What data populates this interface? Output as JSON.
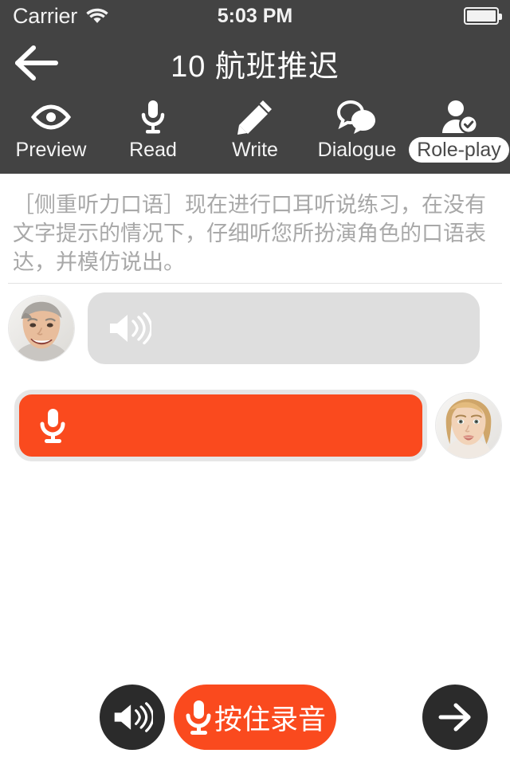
{
  "status_bar": {
    "carrier": "Carrier",
    "wifi_icon": "wifi-icon",
    "time": "5:03 PM",
    "battery_icon": "battery-full-icon"
  },
  "nav": {
    "back_icon": "arrow-left-icon",
    "title": "10 航班推迟"
  },
  "toolbar": {
    "items": [
      {
        "label": "Preview",
        "icon": "eye-icon",
        "active": false
      },
      {
        "label": "Read",
        "icon": "microphone-icon",
        "active": false
      },
      {
        "label": "Write",
        "icon": "pencil-icon",
        "active": false
      },
      {
        "label": "Dialogue",
        "icon": "speech-bubbles-icon",
        "active": false
      },
      {
        "label": "Role-play",
        "icon": "user-check-icon",
        "active": true
      }
    ]
  },
  "instruction": {
    "text": "［侧重听力口语］现在进行口耳听说练习，在没有文字提示的情况下，仔细听您所扮演角色的口语表达，并模仿说出。"
  },
  "dialogue": {
    "rows": [
      {
        "speaker": "avatar-man",
        "side": "left",
        "bubble_icon": "speaker-icon",
        "bubble_color": "#dedede",
        "bubble_text": ""
      },
      {
        "speaker": "avatar-woman",
        "side": "right",
        "bubble_icon": "microphone-icon",
        "bubble_color": "#fa4a1e",
        "bubble_text": ""
      }
    ]
  },
  "bottom_bar": {
    "play_icon": "speaker-icon",
    "record_label": "按住录音",
    "record_icon": "microphone-icon",
    "next_icon": "arrow-right-icon"
  },
  "colors": {
    "accent_orange": "#fa4a1e",
    "header_dark": "#434343",
    "button_dark": "#2b2b2b",
    "bubble_gray": "#dedede",
    "instruction_gray": "#a8a8a8"
  }
}
